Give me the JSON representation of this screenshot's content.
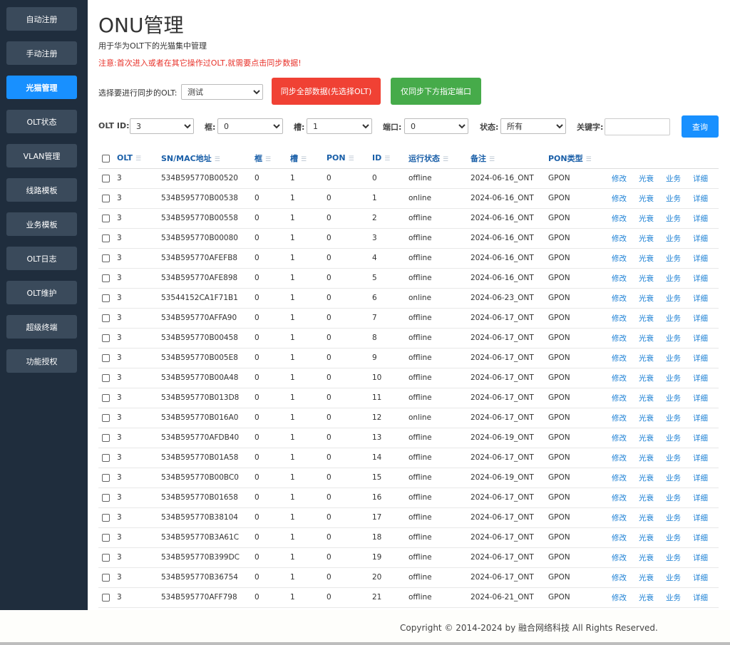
{
  "sidebar": {
    "items": [
      {
        "label": "自动注册",
        "active": false
      },
      {
        "label": "手动注册",
        "active": false
      },
      {
        "label": "光猫管理",
        "active": true
      },
      {
        "label": "OLT状态",
        "active": false
      },
      {
        "label": "VLAN管理",
        "active": false
      },
      {
        "label": "线路模板",
        "active": false
      },
      {
        "label": "业务模板",
        "active": false
      },
      {
        "label": "OLT日志",
        "active": false
      },
      {
        "label": "OLT维护",
        "active": false
      },
      {
        "label": "超级终端",
        "active": false
      },
      {
        "label": "功能授权",
        "active": false
      }
    ]
  },
  "header": {
    "title": "ONU管理",
    "subtitle": "用于华为OLT下的光猫集中管理",
    "notice": "注意:首次进入或者在其它操作过OLT,就需要点击同步数据!"
  },
  "sync": {
    "label": "选择要进行同步的OLT:",
    "selected": "测试",
    "sync_all_label": "同步全部数据(先选择OLT)",
    "sync_port_label": "仅同步下方指定端口"
  },
  "filters": {
    "olt_id_label": "OLT ID:",
    "olt_id_value": "3",
    "frame_label": "框:",
    "frame_value": "0",
    "slot_label": "槽:",
    "slot_value": "1",
    "port_label": "端口:",
    "port_value": "0",
    "status_label": "状态:",
    "status_value": "所有",
    "keyword_label": "关键字:",
    "keyword_value": "",
    "query_label": "查询"
  },
  "table": {
    "headers": [
      "OLT",
      "SN/MAC地址",
      "框",
      "槽",
      "PON",
      "ID",
      "运行状态",
      "备注",
      "PON类型"
    ],
    "actions": [
      "修改",
      "光衰",
      "业务",
      "详细"
    ],
    "rows": [
      [
        "3",
        "534B595770B00520",
        "0",
        "1",
        "0",
        "0",
        "offline",
        "2024-06-16_ONT",
        "GPON"
      ],
      [
        "3",
        "534B595770B00538",
        "0",
        "1",
        "0",
        "1",
        "online",
        "2024-06-16_ONT",
        "GPON"
      ],
      [
        "3",
        "534B595770B00558",
        "0",
        "1",
        "0",
        "2",
        "offline",
        "2024-06-16_ONT",
        "GPON"
      ],
      [
        "3",
        "534B595770B00080",
        "0",
        "1",
        "0",
        "3",
        "offline",
        "2024-06-16_ONT",
        "GPON"
      ],
      [
        "3",
        "534B595770AFEFB8",
        "0",
        "1",
        "0",
        "4",
        "offline",
        "2024-06-16_ONT",
        "GPON"
      ],
      [
        "3",
        "534B595770AFE898",
        "0",
        "1",
        "0",
        "5",
        "offline",
        "2024-06-16_ONT",
        "GPON"
      ],
      [
        "3",
        "53544152CA1F71B1",
        "0",
        "1",
        "0",
        "6",
        "online",
        "2024-06-23_ONT",
        "GPON"
      ],
      [
        "3",
        "534B595770AFFA90",
        "0",
        "1",
        "0",
        "7",
        "offline",
        "2024-06-17_ONT",
        "GPON"
      ],
      [
        "3",
        "534B595770B00458",
        "0",
        "1",
        "0",
        "8",
        "offline",
        "2024-06-17_ONT",
        "GPON"
      ],
      [
        "3",
        "534B595770B005E8",
        "0",
        "1",
        "0",
        "9",
        "offline",
        "2024-06-17_ONT",
        "GPON"
      ],
      [
        "3",
        "534B595770B00A48",
        "0",
        "1",
        "0",
        "10",
        "offline",
        "2024-06-17_ONT",
        "GPON"
      ],
      [
        "3",
        "534B595770B013D8",
        "0",
        "1",
        "0",
        "11",
        "offline",
        "2024-06-17_ONT",
        "GPON"
      ],
      [
        "3",
        "534B595770B016A0",
        "0",
        "1",
        "0",
        "12",
        "online",
        "2024-06-17_ONT",
        "GPON"
      ],
      [
        "3",
        "534B595770AFDB40",
        "0",
        "1",
        "0",
        "13",
        "offline",
        "2024-06-19_ONT",
        "GPON"
      ],
      [
        "3",
        "534B595770B01A58",
        "0",
        "1",
        "0",
        "14",
        "offline",
        "2024-06-17_ONT",
        "GPON"
      ],
      [
        "3",
        "534B595770B00BC0",
        "0",
        "1",
        "0",
        "15",
        "offline",
        "2024-06-19_ONT",
        "GPON"
      ],
      [
        "3",
        "534B595770B01658",
        "0",
        "1",
        "0",
        "16",
        "offline",
        "2024-06-17_ONT",
        "GPON"
      ],
      [
        "3",
        "534B595770B38104",
        "0",
        "1",
        "0",
        "17",
        "offline",
        "2024-06-17_ONT",
        "GPON"
      ],
      [
        "3",
        "534B595770B3A61C",
        "0",
        "1",
        "0",
        "18",
        "offline",
        "2024-06-17_ONT",
        "GPON"
      ],
      [
        "3",
        "534B595770B399DC",
        "0",
        "1",
        "0",
        "19",
        "offline",
        "2024-06-17_ONT",
        "GPON"
      ],
      [
        "3",
        "534B595770B36754",
        "0",
        "1",
        "0",
        "20",
        "offline",
        "2024-06-17_ONT",
        "GPON"
      ],
      [
        "3",
        "534B595770AFF798",
        "0",
        "1",
        "0",
        "21",
        "offline",
        "2024-06-21_ONT",
        "GPON"
      ]
    ]
  },
  "footer": {
    "copyright": "Copyright © 2014-2024 by 融合网络科技 All Rights Reserved."
  },
  "colors": {
    "sidebar_bg": "#1f2d3d",
    "active": "#1890ff",
    "danger": "#f04134",
    "success": "#46ab4a",
    "link": "#1a7fd4"
  }
}
